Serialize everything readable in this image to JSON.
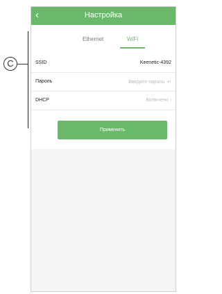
{
  "header": {
    "back_icon": "chevron-left-icon",
    "back_glyph": "‹",
    "title": "Настройка"
  },
  "tabs": [
    {
      "label": "Ethernet",
      "active": false
    },
    {
      "label": "WiFi",
      "active": true
    }
  ],
  "rows": {
    "ssid": {
      "label": "SSID",
      "value": "Keenetic-4392"
    },
    "password": {
      "label": "Пароль",
      "placeholder": "Введите пароль",
      "icon": "keyboard-return-icon",
      "icon_glyph": "↵"
    },
    "dhcp": {
      "label": "DHCP",
      "value": "Включено",
      "arrow": "›"
    }
  },
  "apply_label": "Применить",
  "annotation": {
    "marker": "C"
  },
  "colors": {
    "accent": "#6ab96a",
    "placeholder": "#bbbbbb",
    "background": "#f5f5f5"
  }
}
